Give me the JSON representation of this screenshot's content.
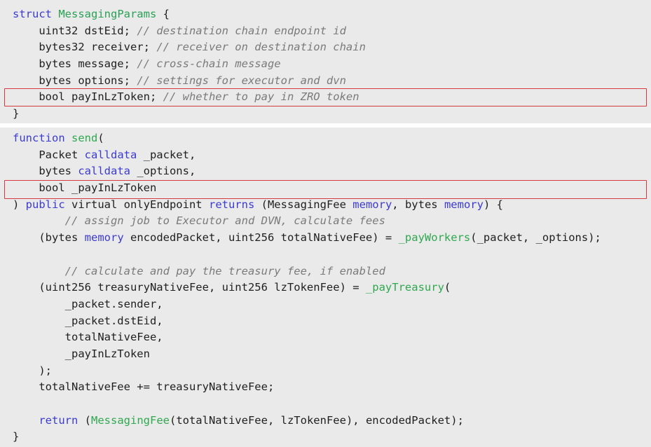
{
  "struct_block": {
    "lines": [
      [
        {
          "t": "struct ",
          "c": "kw"
        },
        {
          "t": "MessagingParams",
          "c": "ty"
        },
        {
          "t": " {",
          "c": ""
        }
      ],
      [
        {
          "t": "    uint32 dstEid; ",
          "c": ""
        },
        {
          "t": "// destination chain endpoint id",
          "c": "cm"
        }
      ],
      [
        {
          "t": "    bytes32 receiver; ",
          "c": ""
        },
        {
          "t": "// receiver on destination chain",
          "c": "cm"
        }
      ],
      [
        {
          "t": "    bytes message; ",
          "c": ""
        },
        {
          "t": "// cross-chain message",
          "c": "cm"
        }
      ],
      [
        {
          "t": "    bytes options; ",
          "c": ""
        },
        {
          "t": "// settings for executor and dvn",
          "c": "cm"
        }
      ],
      [
        {
          "t": "    bool payInLzToken; ",
          "c": ""
        },
        {
          "t": "// whether to pay in ZRO token",
          "c": "cm"
        }
      ],
      [
        {
          "t": "}",
          "c": ""
        }
      ]
    ]
  },
  "function_block": {
    "lines": [
      [
        {
          "t": "function ",
          "c": "kw"
        },
        {
          "t": "send",
          "c": "fn"
        },
        {
          "t": "(",
          "c": ""
        }
      ],
      [
        {
          "t": "    Packet ",
          "c": ""
        },
        {
          "t": "calldata",
          "c": "kw"
        },
        {
          "t": " _packet,",
          "c": ""
        }
      ],
      [
        {
          "t": "    bytes ",
          "c": ""
        },
        {
          "t": "calldata",
          "c": "kw"
        },
        {
          "t": " _options,",
          "c": ""
        }
      ],
      [
        {
          "t": "    bool _payInLzToken",
          "c": ""
        }
      ],
      [
        {
          "t": ") ",
          "c": ""
        },
        {
          "t": "public",
          "c": "kw"
        },
        {
          "t": " virtual onlyEndpoint ",
          "c": ""
        },
        {
          "t": "returns",
          "c": "kw"
        },
        {
          "t": " (MessagingFee ",
          "c": ""
        },
        {
          "t": "memory",
          "c": "kw"
        },
        {
          "t": ", bytes ",
          "c": ""
        },
        {
          "t": "memory",
          "c": "kw"
        },
        {
          "t": ") {",
          "c": ""
        }
      ],
      [
        {
          "t": "        ",
          "c": ""
        },
        {
          "t": "// assign job to Executor and DVN, calculate fees",
          "c": "cm"
        }
      ],
      [
        {
          "t": "    (bytes ",
          "c": ""
        },
        {
          "t": "memory",
          "c": "kw"
        },
        {
          "t": " encodedPacket, uint256 totalNativeFee) = ",
          "c": ""
        },
        {
          "t": "_payWorkers",
          "c": "fn"
        },
        {
          "t": "(_packet, _options);",
          "c": ""
        }
      ],
      [
        {
          "t": "",
          "c": ""
        }
      ],
      [
        {
          "t": "        ",
          "c": ""
        },
        {
          "t": "// calculate and pay the treasury fee, if enabled",
          "c": "cm"
        }
      ],
      [
        {
          "t": "    (uint256 treasuryNativeFee, uint256 lzTokenFee) = ",
          "c": ""
        },
        {
          "t": "_payTreasury",
          "c": "fn"
        },
        {
          "t": "(",
          "c": ""
        }
      ],
      [
        {
          "t": "        _packet.sender,",
          "c": ""
        }
      ],
      [
        {
          "t": "        _packet.dstEid,",
          "c": ""
        }
      ],
      [
        {
          "t": "        totalNativeFee,",
          "c": ""
        }
      ],
      [
        {
          "t": "        _payInLzToken",
          "c": ""
        }
      ],
      [
        {
          "t": "    );",
          "c": ""
        }
      ],
      [
        {
          "t": "    totalNativeFee += treasuryNativeFee;",
          "c": ""
        }
      ],
      [
        {
          "t": "",
          "c": ""
        }
      ],
      [
        {
          "t": "    ",
          "c": ""
        },
        {
          "t": "return",
          "c": "kw"
        },
        {
          "t": " (",
          "c": ""
        },
        {
          "t": "MessagingFee",
          "c": "fn"
        },
        {
          "t": "(totalNativeFee, lzTokenFee), encodedPacket);",
          "c": ""
        }
      ],
      [
        {
          "t": "}",
          "c": ""
        }
      ]
    ]
  },
  "colors": {
    "keyword": "#3b3bd1",
    "function_name": "#2fa84f",
    "comment": "#7a7a7a",
    "highlight_border": "#d6393f",
    "background": "#eaeaea"
  }
}
